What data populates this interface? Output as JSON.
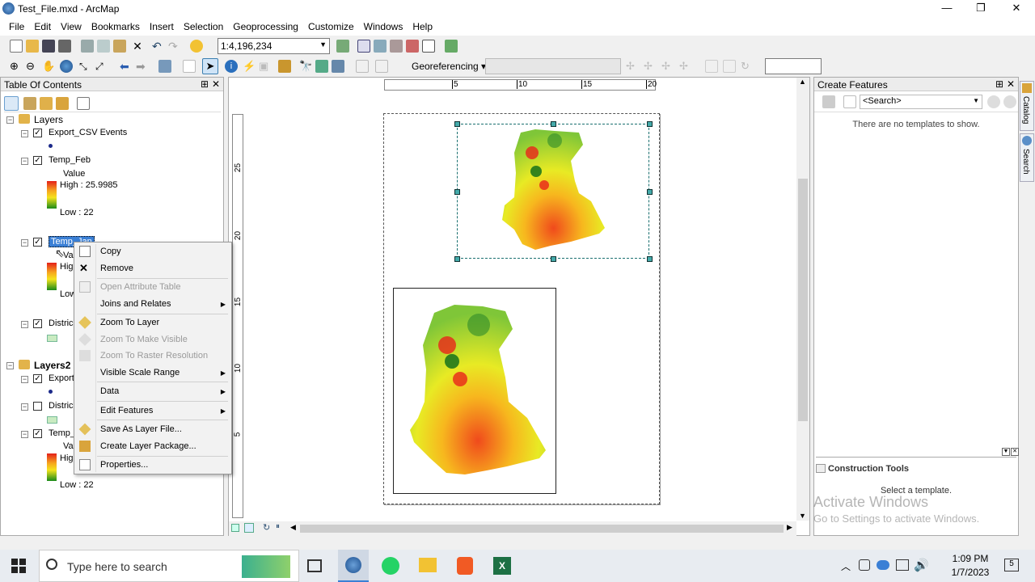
{
  "window": {
    "title": "Test_File.mxd - ArcMap",
    "minimize": "—",
    "maximize": "❐",
    "close": "✕"
  },
  "menu": [
    "File",
    "Edit",
    "View",
    "Bookmarks",
    "Insert",
    "Selection",
    "Geoprocessing",
    "Customize",
    "Windows",
    "Help"
  ],
  "toolbar": {
    "scale": "1:4,196,234",
    "georef_label": "Georeferencing ▾"
  },
  "toc": {
    "title": "Table Of Contents",
    "pin": "⊞",
    "close": "✕",
    "group1": "Layers",
    "l1": "Export_CSV Events",
    "l2": "Temp_Feb",
    "l2_value": "Value",
    "l2_high": "High : 25.9985",
    "l2_low": "Low : 22",
    "l3": "Temp_Jan",
    "l3_value": "Val",
    "l3_high": "Hig",
    "l3_low": "Low",
    "l4": "Distric",
    "group2": "Layers2",
    "l5": "Export",
    "l6": "Distric",
    "l7": "Temp_",
    "l7_value": "Va",
    "l7_high": "Hig",
    "l7_low": "Low : 22"
  },
  "context_menu": {
    "copy": "Copy",
    "remove": "Remove",
    "open_attr": "Open Attribute Table",
    "joins": "Joins and Relates",
    "zoom_layer": "Zoom To Layer",
    "zoom_visible": "Zoom To Make Visible",
    "zoom_raster": "Zoom To Raster Resolution",
    "scale_range": "Visible Scale Range",
    "data": "Data",
    "edit_features": "Edit Features",
    "save_layer": "Save As Layer File...",
    "create_pkg": "Create Layer Package...",
    "properties": "Properties..."
  },
  "ruler": {
    "h": [
      "5",
      "10",
      "15",
      "20"
    ],
    "v": [
      "25",
      "20",
      "15",
      "10",
      "5"
    ]
  },
  "create_features": {
    "title": "Create Features",
    "search": "<Search>",
    "empty": "There are no templates to show.",
    "construction": "Construction Tools",
    "select_template": "Select a template.",
    "side_catalog": "Catalog",
    "side_search": "Search"
  },
  "watermark": {
    "line1": "Activate Windows",
    "line2": "Go to Settings to activate Windows."
  },
  "taskbar": {
    "search": "Type here to search",
    "time": "1:09 PM",
    "date": "1/7/2023",
    "notif": "5"
  }
}
